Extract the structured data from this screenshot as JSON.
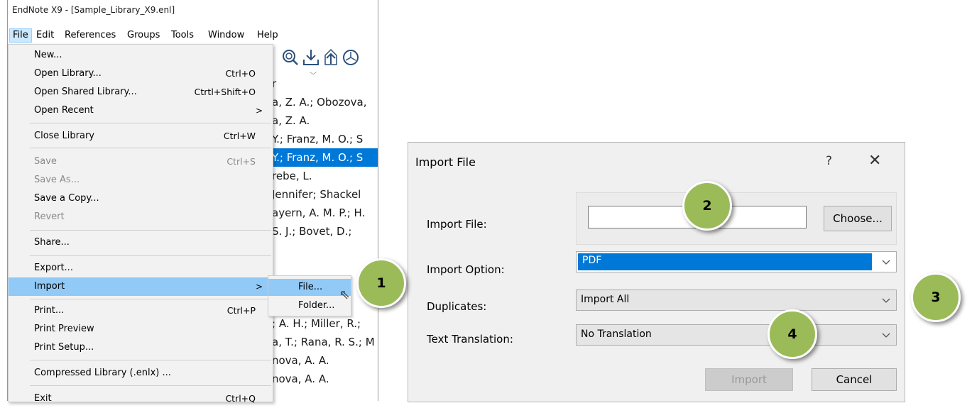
{
  "window": {
    "title": "EndNote X9 - [Sample_Library_X9.enl]",
    "menubar": [
      "File",
      "Edit",
      "References",
      "Groups",
      "Tools",
      "Window",
      "Help"
    ]
  },
  "toolbar": {
    "icons": [
      "online-search-icon",
      "import-icon",
      "export-icon",
      "pdf-icon"
    ]
  },
  "authors": {
    "header": "r",
    "rows": [
      "a, Z. A.; Obozova,",
      "a, Z. A.",
      "Y.; Franz, M. O.; S",
      "Y.; Franz, M. O.; S",
      "rebe, L.",
      "Jennifer; Shackel",
      "ayern, A. M. P.; H.",
      "S. J.; Bovet, D.;",
      "",
      "",
      "; A. H.; Miller, R.;",
      "a, T.; Rana, R. S.; M",
      "nova, A. A.",
      "nova, A. A."
    ],
    "selected_index": 3
  },
  "file_menu": {
    "items": [
      {
        "label": "New...",
        "shortcut": ""
      },
      {
        "label": "Open Library...",
        "shortcut": "Ctrl+O"
      },
      {
        "label": "Open Shared Library...",
        "shortcut": "Ctrtl+Shift+O"
      },
      {
        "label": "Open Recent",
        "shortcut": "",
        "arrow": ">"
      },
      {
        "label": "Close Library",
        "shortcut": "Ctrl+W"
      },
      {
        "label": "Save",
        "shortcut": "Ctrl+S",
        "disabled": true
      },
      {
        "label": "Save As...",
        "shortcut": "",
        "disabled": true
      },
      {
        "label": "Save a Copy...",
        "shortcut": ""
      },
      {
        "label": "Revert",
        "shortcut": "",
        "disabled": true
      },
      {
        "label": "Share...",
        "shortcut": ""
      },
      {
        "label": "Export...",
        "shortcut": ""
      },
      {
        "label": "Import",
        "shortcut": "",
        "arrow": ">"
      },
      {
        "label": "Print...",
        "shortcut": "Ctrl+P"
      },
      {
        "label": "Print Preview",
        "shortcut": ""
      },
      {
        "label": "Print Setup...",
        "shortcut": ""
      },
      {
        "label": "Compressed Library (.enlx) ...",
        "shortcut": ""
      },
      {
        "label": "Exit",
        "shortcut": "Ctrl+Q"
      }
    ],
    "highlighted": "Import"
  },
  "import_submenu": {
    "items": [
      "File...",
      "Folder..."
    ],
    "highlighted": "File..."
  },
  "dialog": {
    "title": "Import File",
    "help": "?",
    "close": "✕",
    "import_file_label": "Import File:",
    "import_file_value": "",
    "choose_button": "Choose...",
    "import_option_label": "Import Option:",
    "import_option_value": "PDF",
    "duplicates_label": "Duplicates:",
    "duplicates_value": "Import All",
    "text_translation_label": "Text Translation:",
    "text_translation_value": "No Translation",
    "import_button": "Import",
    "cancel_button": "Cancel"
  },
  "badges": [
    "1",
    "2",
    "3",
    "4"
  ],
  "colors": {
    "selection": "#0078d7",
    "menu_highlight": "#91c9f7",
    "badge_fill": "#9bbb59"
  }
}
